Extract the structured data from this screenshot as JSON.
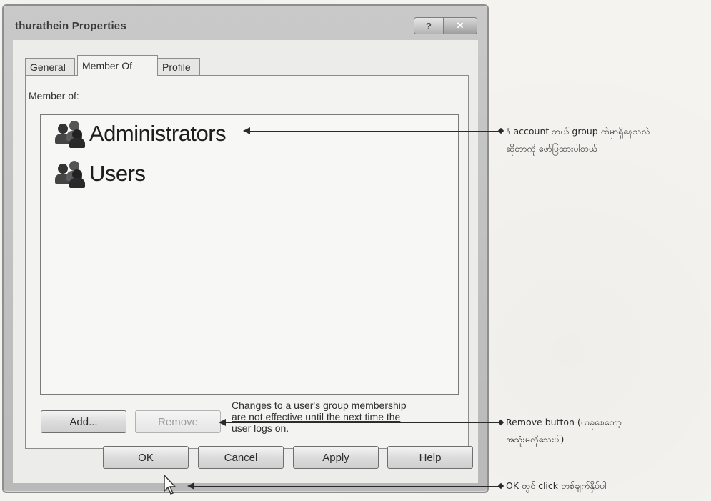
{
  "window": {
    "title": "thurathein Properties",
    "help_glyph": "?",
    "close_glyph": "✕"
  },
  "tabs": [
    {
      "label": "General",
      "active": false
    },
    {
      "label": "Member Of",
      "active": true
    },
    {
      "label": "Profile",
      "active": false
    }
  ],
  "member_of": {
    "label": "Member of:",
    "groups": [
      {
        "name": "Administrators",
        "icon": "group-icon"
      },
      {
        "name": "Users",
        "icon": "group-icon"
      }
    ]
  },
  "buttons": {
    "add": "Add...",
    "remove": "Remove",
    "ok": "OK",
    "cancel": "Cancel",
    "apply": "Apply",
    "help": "Help"
  },
  "note": {
    "line1": "Changes to a user's group membership",
    "line2": "are not effective until the next time the",
    "line3": "user logs on."
  },
  "annotations": {
    "groups_line1": "ဒီ account ဘယ် group ထဲမှာရှိနေသလဲ",
    "groups_line2": "ဆိုတာကို ဖော်ပြထားပါတယ်",
    "remove_line1": "Remove button (ယခုစေတော့",
    "remove_line2": "အသုံးမလိုသေးပါ)",
    "ok_line1": "OK တွင် click တစ်ချက်နှိပ်ပါ"
  },
  "colors": {
    "window_frame": "#b9b9b9",
    "client_bg": "#ececea",
    "page_bg": "#f4f3ef"
  }
}
